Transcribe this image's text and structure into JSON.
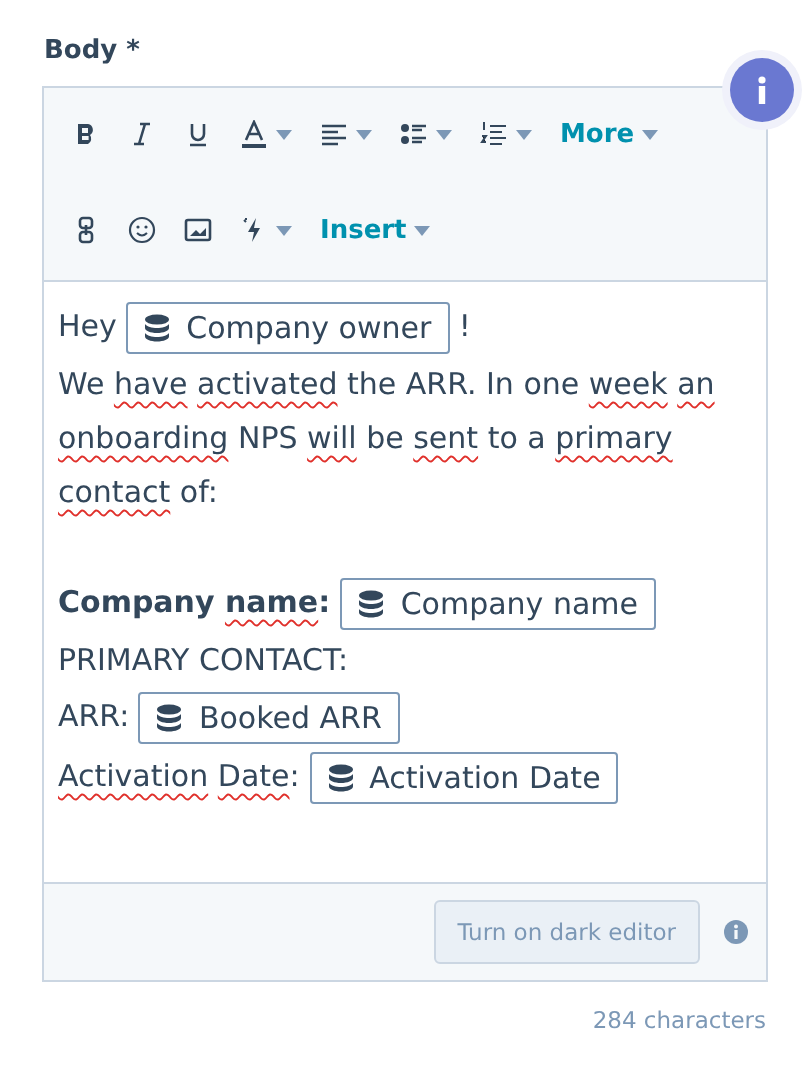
{
  "field": {
    "label": "Body *"
  },
  "toolbar": [
    [
      {
        "kind": "bold",
        "caret": false
      },
      {
        "kind": "italic",
        "caret": false
      },
      {
        "kind": "underline",
        "caret": false
      },
      {
        "kind": "text-color",
        "caret": true
      },
      {
        "kind": "align",
        "caret": true
      },
      {
        "kind": "bullets",
        "caret": true
      },
      {
        "kind": "numbered",
        "caret": true
      },
      {
        "kind": "menu",
        "label": "More",
        "caret": true
      }
    ],
    [
      {
        "kind": "link",
        "caret": false
      },
      {
        "kind": "emoji",
        "caret": false
      },
      {
        "kind": "image",
        "caret": false
      },
      {
        "kind": "lightning",
        "caret": true
      },
      {
        "kind": "menu",
        "label": "Insert",
        "caret": true
      }
    ]
  ],
  "body": [
    [
      {
        "kind": "text",
        "text": "Hey "
      },
      {
        "kind": "token",
        "text": "Company owner"
      },
      {
        "kind": "text",
        "text": " !"
      }
    ],
    [
      {
        "kind": "text",
        "text": "We "
      },
      {
        "kind": "misspelled",
        "words": [
          "have",
          "activated"
        ]
      },
      {
        "kind": "text",
        "text": " the ARR. In one "
      },
      {
        "kind": "misspelled",
        "words": [
          "week",
          "an",
          "onboarding"
        ]
      },
      {
        "kind": "text",
        "text": " NPS "
      },
      {
        "kind": "misspelled",
        "words": [
          "will"
        ]
      },
      {
        "kind": "text",
        "text": " be "
      },
      {
        "kind": "misspelled",
        "words": [
          "sent"
        ]
      },
      {
        "kind": "text",
        "text": " to a "
      },
      {
        "kind": "misspelled",
        "words": [
          "primary",
          "contact"
        ]
      },
      {
        "kind": "text",
        "text": " of:"
      }
    ],
    [
      {
        "kind": "bold",
        "text": "Company "
      },
      {
        "kind": "bold-misspelled",
        "text": "name"
      },
      {
        "kind": "bold",
        "text": ": "
      },
      {
        "kind": "token",
        "text": "Company name"
      }
    ],
    [
      {
        "kind": "text",
        "text": "PRIMARY CONTACT:"
      }
    ],
    [
      {
        "kind": "text",
        "text": "ARR: "
      },
      {
        "kind": "token",
        "text": "Booked ARR"
      }
    ],
    [
      {
        "kind": "misspelled",
        "words": [
          "Activation",
          "Date"
        ]
      },
      {
        "kind": "text",
        "text": ": "
      },
      {
        "kind": "token",
        "text": "Activation Date"
      }
    ]
  ],
  "footer": {
    "button": "Turn on dark editor"
  },
  "count": "284 characters"
}
